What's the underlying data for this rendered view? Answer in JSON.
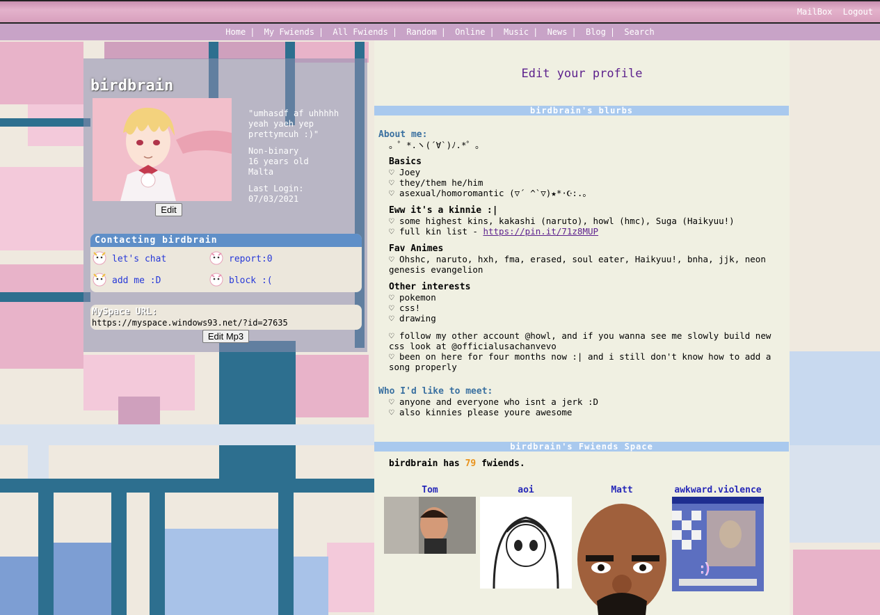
{
  "header": {
    "links": [
      "MailBox",
      "Logout"
    ]
  },
  "nav": {
    "items": [
      "Home",
      "My Fwiends",
      "All Fwiends",
      "Random",
      "Online",
      "Music",
      "News",
      "Blog",
      "Search"
    ]
  },
  "profile": {
    "name": "birdbrain",
    "mood": "\"umhasdf af uhhhhh yeah yaeh yep prettymcuh :)\"",
    "gender": "Non-binary",
    "age": "16 years old",
    "location": "Malta",
    "last_login_label": "Last Login:",
    "last_login": "07/03/2021",
    "edit_label": "Edit",
    "contact_header": "Contacting birdbrain",
    "contact": {
      "chat": "let's chat",
      "report": "report:0",
      "add": "add me :D",
      "block": "block :("
    },
    "url_label": "MySpace URL:",
    "url": "https://myspace.windows93.net/?id=27635",
    "edit_mp3_label": "Edit Mp3"
  },
  "main": {
    "edit_title": "Edit your profile",
    "blurbs_header": "birdbrain's blurbs",
    "about_label": "About me:",
    "about_line": "。゜*.ヽ(´∀`)ﾉ.*゜。",
    "basics_label": "Basics",
    "basics": [
      "♡ Joey",
      "♡ they/them he/him",
      "♡ asexual/homoromantic (▽´ ^`▽)★*·☪︎:.｡"
    ],
    "kinnie_label": "Eww it's a kinnie :|",
    "kinnie": [
      "♡ some highest kins, kakashi (naruto), howl (hmc), Suga (Haikyuu!)"
    ],
    "kin_list_prefix": "♡ full kin list - ",
    "kin_list_link": "https://pin.it/71z8MUP",
    "anime_label": "Fav Animes",
    "anime": "♡ Ohshc, naruto, hxh, fma, erased, soul eater, Haikyuu!, bnha, jjk, neon genesis evangelion",
    "interests_label": "Other interests",
    "interests": [
      "♡ pokemon",
      "♡ css!",
      "♡ drawing"
    ],
    "extra1": "♡ follow my other account @howl, and if you wanna see me slowly build new css look at @officialusachanvevo",
    "extra2": "♡ been on here for four months now :| and i still don't know how to add a song properly",
    "meet_label": "Who I'd like to meet:",
    "meet": [
      "♡ anyone and everyone who isnt a jerk :D",
      "♡ also kinnies please youre awesome"
    ],
    "friends_header": "birdbrain's Fwiends Space",
    "friends_prefix": "birdbrain has",
    "friends_count": "79",
    "friends_suffix": "fwiends.",
    "friends": [
      {
        "name": "Tom"
      },
      {
        "name": "aoi"
      },
      {
        "name": "Matt"
      },
      {
        "name": "awkward.violence"
      }
    ]
  },
  "colors": {
    "accent_purple": "#5b1f8c",
    "link_blue": "#2638d8",
    "section_blue": "#a9c9ee",
    "count_orange": "#e8921c"
  }
}
